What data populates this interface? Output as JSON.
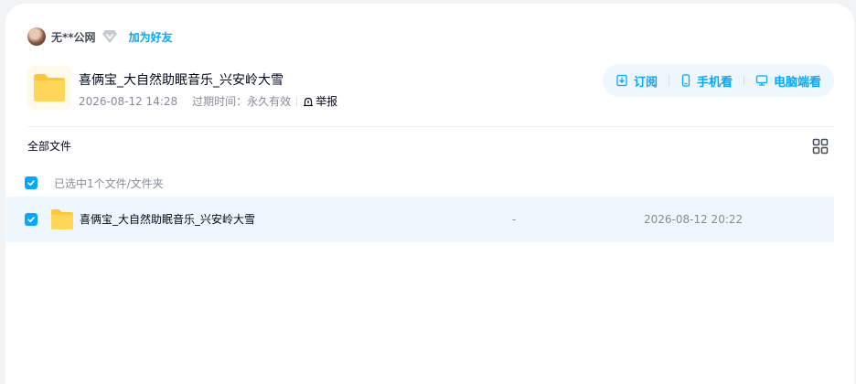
{
  "sharer": {
    "username": "无**公网",
    "add_friend_label": "加为好友"
  },
  "share": {
    "title": "喜俩宝_大自然助眠音乐_兴安岭大雪",
    "share_time": "2026-08-12 14:28",
    "expire_label": "过期时间：",
    "expire_value": "永久有效",
    "report_label": "举报"
  },
  "actions": {
    "subscribe_label": "订阅",
    "mobile_label": "手机看",
    "pc_label": "电脑端看"
  },
  "breadcrumb": {
    "all_files_label": "全部文件"
  },
  "selection": {
    "summary": "已选中1个文件/文件夹"
  },
  "files": [
    {
      "name": "喜俩宝_大自然助眠音乐_兴安岭大雪",
      "size": "-",
      "modified": "2026-08-12 20:22",
      "checked": true
    }
  ],
  "colors": {
    "accent": "#06a7ff",
    "accent_bg": "#eef7fe",
    "folder": "#ffc63a"
  }
}
